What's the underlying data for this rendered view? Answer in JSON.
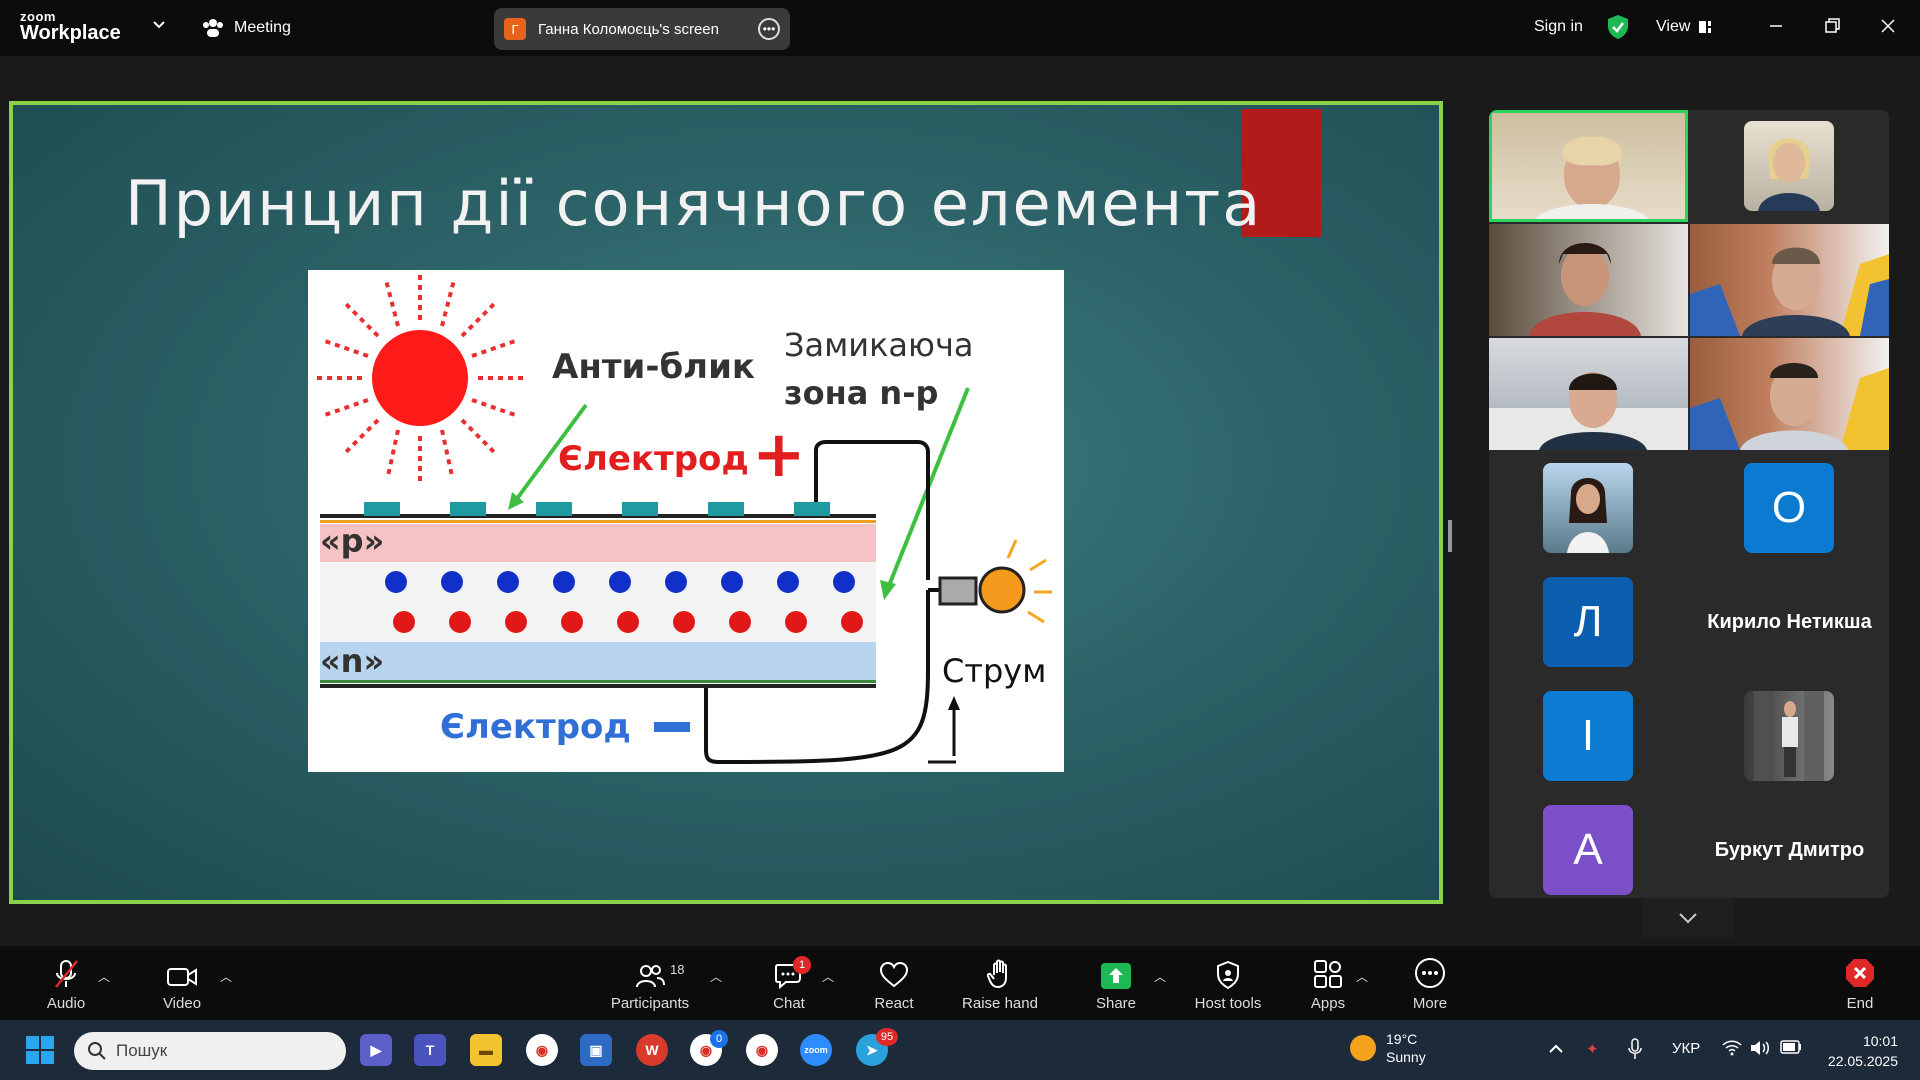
{
  "app": {
    "logo_top": "zoom",
    "logo_bottom": "Workplace",
    "meeting_label": "Meeting"
  },
  "share": {
    "initial": "Г",
    "label": "Ганна Коломоєць's screen"
  },
  "topbar": {
    "sign_in": "Sign in",
    "view": "View"
  },
  "slide": {
    "title": "Принцип дії сонячного елемента",
    "diagram": {
      "anti": "Анти-блик",
      "zone1": "Замикаюча",
      "zone2": "зона n-p",
      "elec_plus": "Єлектрод",
      "plus": "+",
      "p": "«p»",
      "n": "«n»",
      "current": "Струм",
      "elec_minus": "Єлектрод",
      "minus": "—"
    }
  },
  "gallery": {
    "avatars": [
      {
        "letter": "О",
        "color": "#0b7bd1"
      },
      {
        "letter": "Л",
        "color": "#0b5fae"
      },
      {
        "letter": "І",
        "color": "#0b7bd1"
      },
      {
        "letter": "А",
        "color": "#7a4fc8"
      }
    ],
    "names": [
      "Кирило Нетикша",
      "Буркут Дмитро"
    ]
  },
  "toolbar": {
    "audio": "Audio",
    "video": "Video",
    "participants": "Participants",
    "participants_count": "18",
    "chat": "Chat",
    "chat_badge": "1",
    "react": "React",
    "raise_hand": "Raise hand",
    "share": "Share",
    "host_tools": "Host tools",
    "apps": "Apps",
    "more": "More",
    "end": "End"
  },
  "taskbar": {
    "search_placeholder": "Пошук",
    "weather_temp": "19°C",
    "weather_desc": "Sunny",
    "lang": "УКР",
    "time": "10:01",
    "date": "22.05.2025",
    "chrome_badge": "0",
    "telegram_badge": "95"
  }
}
